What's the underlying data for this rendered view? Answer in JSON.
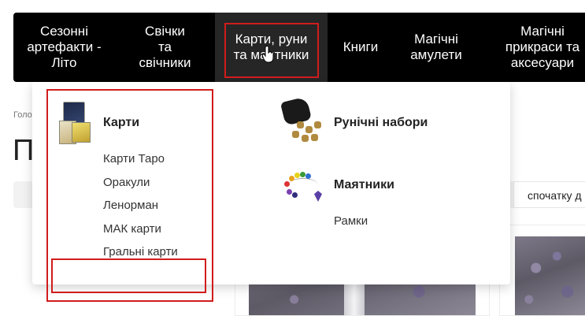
{
  "nav": {
    "items": [
      {
        "label": "Сезонні\nартефакти -\nЛіто"
      },
      {
        "label": "Свічки\nта\nсвічники"
      },
      {
        "label": "Карти, руни\nта маятники"
      },
      {
        "label": "Книги"
      },
      {
        "label": "Магічні\nамулети"
      },
      {
        "label": "Магічні\nприкраси та\nаксесуари"
      }
    ]
  },
  "dropdown": {
    "columns": [
      {
        "groups": [
          {
            "title": "Карти",
            "thumb_icon": "tarot-cards-thumbnail",
            "links": [
              "Карти Таро",
              "Оракули",
              "Ленорман",
              "МАК карти",
              "Гральні карти"
            ]
          }
        ]
      },
      {
        "groups": [
          {
            "title": "Рунічні набори",
            "thumb_icon": "rune-set-thumbnail",
            "links": []
          },
          {
            "title": "Маятники",
            "thumb_icon": "pendulum-thumbnail",
            "links": [
              "Рамки"
            ]
          }
        ]
      }
    ]
  },
  "page": {
    "breadcrumb": "Голо",
    "title": "П",
    "sort_label": "спочатку д"
  },
  "colors": {
    "nav_bg": "#000000",
    "nav_active_bg": "#262626",
    "highlight": "#d11c1c"
  }
}
